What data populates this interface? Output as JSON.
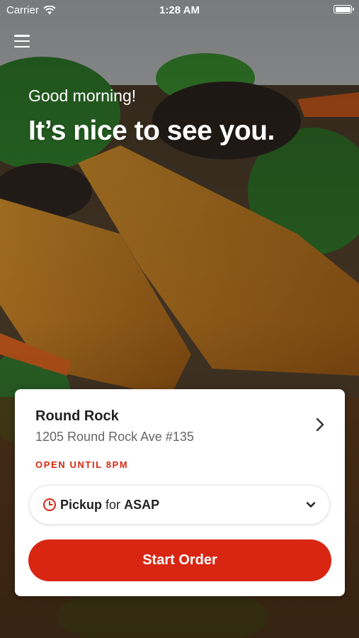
{
  "status_bar": {
    "carrier": "Carrier",
    "time": "1:28 AM"
  },
  "hero": {
    "greeting": "Good morning!",
    "headline": "It’s nice to see you."
  },
  "location": {
    "name": "Round Rock",
    "address": "1205 Round Rock Ave #135",
    "hours": "OPEN UNTIL 8PM"
  },
  "order_mode": {
    "mode": "Pickup",
    "connector": "for",
    "time": "ASAP"
  },
  "actions": {
    "start_order": "Start Order"
  },
  "colors": {
    "accent": "#d92612",
    "hours_text": "#d42a12"
  },
  "icons": [
    "wifi-icon",
    "battery-icon",
    "hamburger-menu-icon",
    "chevron-right-icon",
    "clock-icon",
    "chevron-down-icon"
  ]
}
